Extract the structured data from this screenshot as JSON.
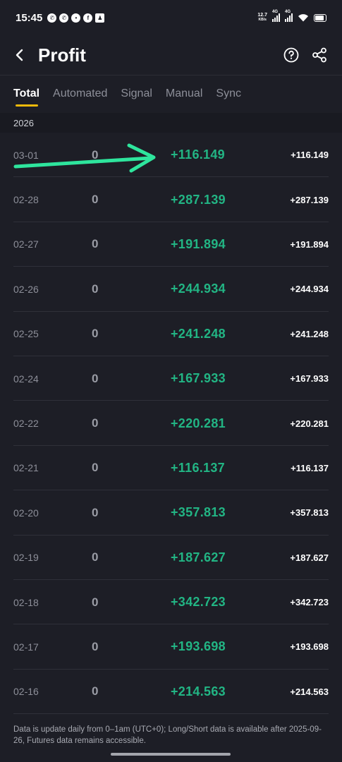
{
  "status_bar": {
    "time": "15:45",
    "net_speed_value": "12.7",
    "net_speed_unit": "KB/s",
    "signal_label_1": "4G",
    "signal_label_2": "4G"
  },
  "header": {
    "title": "Profit",
    "back_icon": "chevron-left-icon",
    "help_icon": "question-circle-icon",
    "share_icon": "share-icon"
  },
  "tabs": [
    {
      "label": "Total",
      "active": true
    },
    {
      "label": "Automated",
      "active": false
    },
    {
      "label": "Signal",
      "active": false
    },
    {
      "label": "Manual",
      "active": false
    },
    {
      "label": "Sync",
      "active": false
    }
  ],
  "year": "2026",
  "rows": [
    {
      "date": "03-01",
      "zero": "0",
      "profit": "+116.149",
      "total": "+116.149"
    },
    {
      "date": "02-28",
      "zero": "0",
      "profit": "+287.139",
      "total": "+287.139"
    },
    {
      "date": "02-27",
      "zero": "0",
      "profit": "+191.894",
      "total": "+191.894"
    },
    {
      "date": "02-26",
      "zero": "0",
      "profit": "+244.934",
      "total": "+244.934"
    },
    {
      "date": "02-25",
      "zero": "0",
      "profit": "+241.248",
      "total": "+241.248"
    },
    {
      "date": "02-24",
      "zero": "0",
      "profit": "+167.933",
      "total": "+167.933"
    },
    {
      "date": "02-22",
      "zero": "0",
      "profit": "+220.281",
      "total": "+220.281"
    },
    {
      "date": "02-21",
      "zero": "0",
      "profit": "+116.137",
      "total": "+116.137"
    },
    {
      "date": "02-20",
      "zero": "0",
      "profit": "+357.813",
      "total": "+357.813"
    },
    {
      "date": "02-19",
      "zero": "0",
      "profit": "+187.627",
      "total": "+187.627"
    },
    {
      "date": "02-18",
      "zero": "0",
      "profit": "+342.723",
      "total": "+342.723"
    },
    {
      "date": "02-17",
      "zero": "0",
      "profit": "+193.698",
      "total": "+193.698"
    },
    {
      "date": "02-16",
      "zero": "0",
      "profit": "+214.563",
      "total": "+214.563"
    }
  ],
  "footer": {
    "note": "Data is update daily from 0–1am (UTC+0); Long/Short data is available after 2025-09-26, Futures data remains accessible."
  },
  "colors": {
    "background": "#1d1e26",
    "profit_green": "#22b584",
    "tab_indicator": "#f0b90b",
    "annotation_arrow": "#2ee59d"
  }
}
